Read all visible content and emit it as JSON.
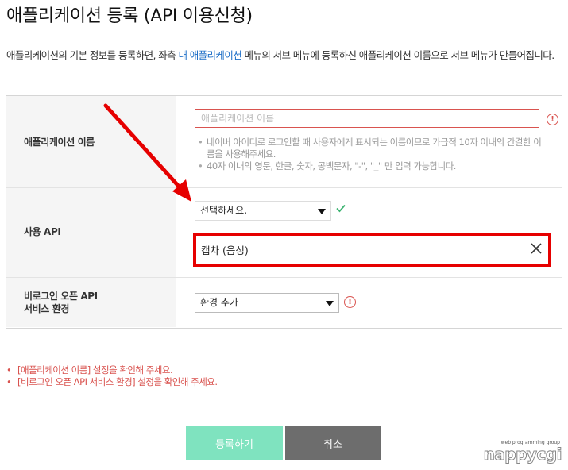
{
  "page": {
    "title": "애플리케이션 등록 (API 이용신청)",
    "intro_before": "애플리케이션의 기본 정보를 등록하면, 좌측 ",
    "intro_link": "내 애플리케이션",
    "intro_after": " 메뉴의 서브 메뉴에 등록하신 애플리케이션 이름으로 서브 메뉴가 만들어집니다."
  },
  "form": {
    "app_name": {
      "label": "애플리케이션 이름",
      "value": "",
      "placeholder": "애플리케이션 이름",
      "error_icon": "!",
      "hints": [
        "네이버 아이디로 로그인할 때 사용자에게 표시되는 이름이므로 가급적 10자 이내의 간결한 이름을 사용해주세요.",
        "40자 이내의 영문, 한글, 숫자, 공백문자, \"-\", \"_\" 만 입력 가능합니다."
      ]
    },
    "api": {
      "label": "사용 API",
      "select_value": "선택하세요.",
      "check_icon": "check-icon",
      "selected_item": "캡차 (음성)",
      "remove_icon": "close-icon"
    },
    "service_env": {
      "label_line1": "비로그인 오픈 API",
      "label_line2": "서비스 환경",
      "select_value": "환경 추가",
      "error_icon": "!"
    }
  },
  "errors": [
    "[애플리케이션 이름] 설정을 확인해 주세요.",
    "[비로그인 오픈 API 서비스 환경] 설정을 확인해 주세요."
  ],
  "buttons": {
    "register": "등록하기",
    "cancel": "취소"
  },
  "watermark": {
    "small": "web programming group",
    "big": "nappycgi"
  },
  "colors": {
    "link": "#1e6fc7",
    "error": "#d9534f",
    "annotation": "#e60000",
    "register_button": "#7fe3bf",
    "cancel_button": "#6d6d6d",
    "check": "#3cb371"
  }
}
